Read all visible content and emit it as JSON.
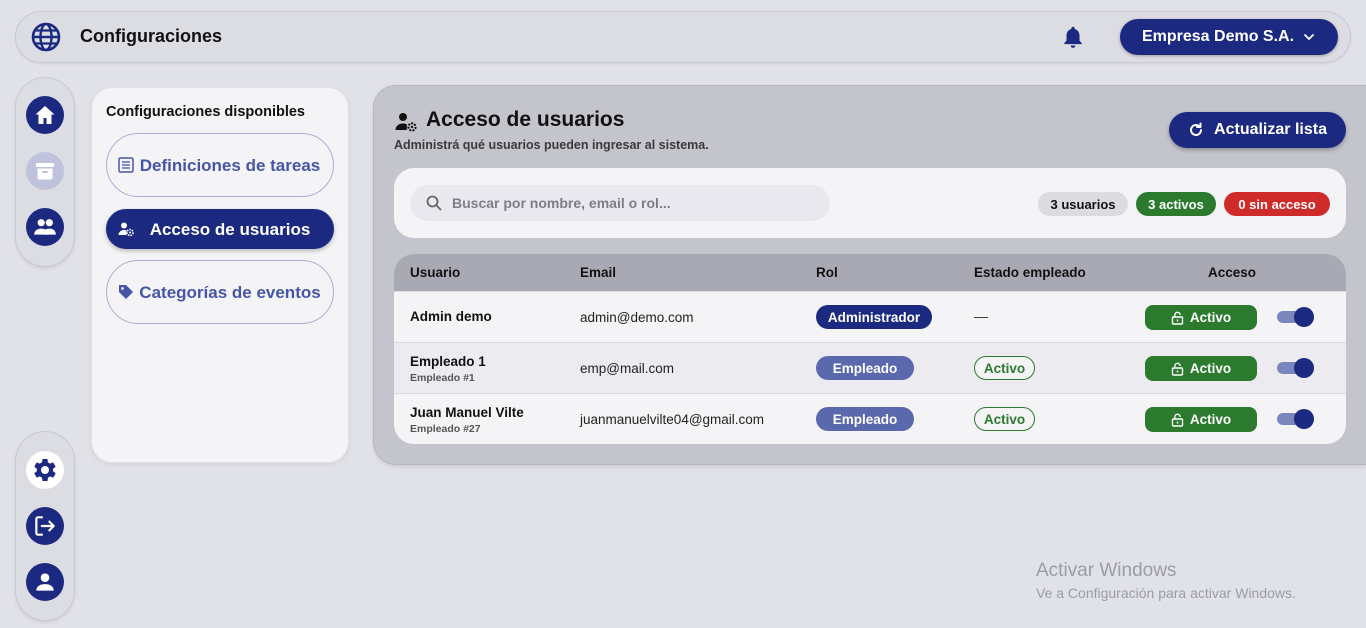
{
  "header": {
    "title": "Configuraciones",
    "globe_icon": "globe-icon",
    "bell_icon": "bell-icon",
    "company": "Empresa Demo S.A.",
    "company_icon": "chevron-down-icon"
  },
  "rail_top": [
    {
      "icon": "home-icon"
    },
    {
      "icon": "archive-icon"
    },
    {
      "icon": "people-icon"
    }
  ],
  "rail_bottom": [
    {
      "icon": "gear-icon"
    },
    {
      "icon": "logout-icon"
    },
    {
      "icon": "user-icon"
    }
  ],
  "config": {
    "heading": "Configuraciones disponibles",
    "items": [
      {
        "label": "Definiciones de tareas",
        "icon": "list-icon",
        "active": false
      },
      {
        "label": "Acceso de usuarios",
        "icon": "user-gear-icon",
        "active": true
      },
      {
        "label": "Categorías de eventos",
        "icon": "tag-icon",
        "active": false
      }
    ]
  },
  "main": {
    "title": "Acceso de usuarios",
    "subtitle": "Administrá qué usuarios pueden ingresar al sistema.",
    "refresh_label": "Actualizar lista",
    "search_placeholder": "Buscar por nombre, email o rol...",
    "badges": {
      "users": "3 usuarios",
      "active": "3 activos",
      "no_access": "0 sin acceso"
    },
    "columns": [
      "Usuario",
      "Email",
      "Rol",
      "Estado empleado",
      "Acceso"
    ],
    "rows": [
      {
        "name": "Admin demo",
        "sub": "",
        "email": "admin@demo.com",
        "role": "Administrador",
        "estado": "—",
        "acceso": "Activo"
      },
      {
        "name": "Empleado 1",
        "sub": "Empleado #1",
        "email": "emp@mail.com",
        "role": "Empleado",
        "estado": "Activo",
        "acceso": "Activo"
      },
      {
        "name": "Juan Manuel Vilte",
        "sub": "Empleado #27",
        "email": "juanmanuelvilte04@gmail.com",
        "role": "Empleado",
        "estado": "Activo",
        "acceso": "Activo"
      }
    ]
  },
  "watermark": {
    "line1": "Activar Windows",
    "line2": "Ve a Configuración para activar Windows."
  },
  "colors": {
    "primary": "#1b2a80",
    "success": "#2b7a2e",
    "danger": "#cf2b2b"
  }
}
